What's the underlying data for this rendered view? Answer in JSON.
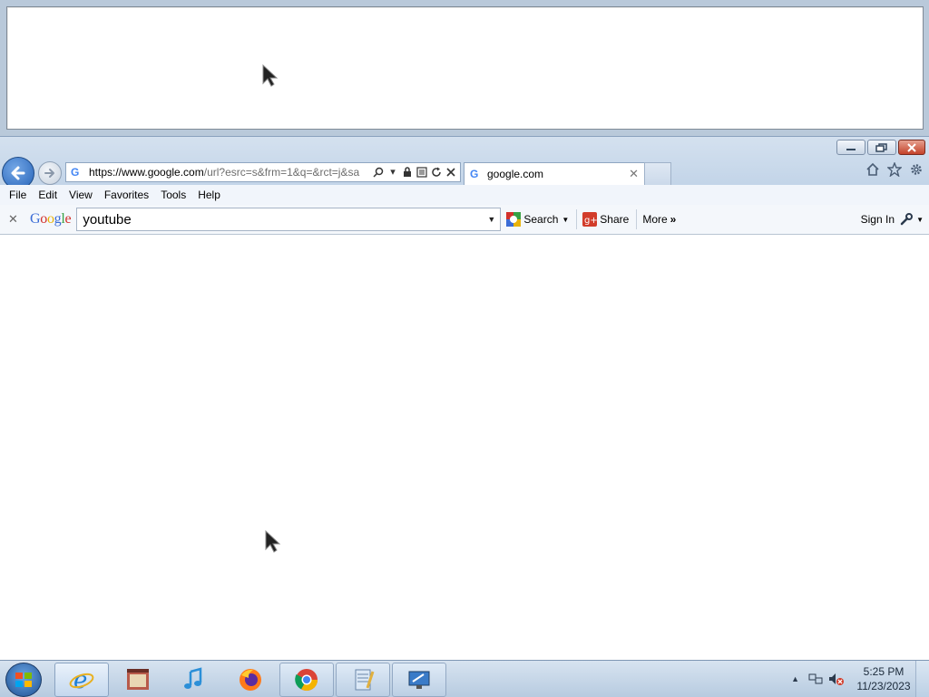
{
  "browser": {
    "address_url_host": "https://www.google.com",
    "address_url_rest": "/url?esrc=s&frm=1&q=&rct=j&sa",
    "tab_title": "google.com",
    "menu": [
      "File",
      "Edit",
      "View",
      "Favorites",
      "Tools",
      "Help"
    ]
  },
  "google_toolbar": {
    "logo": [
      "G",
      "o",
      "o",
      "g",
      "l",
      "e"
    ],
    "search_value": "youtube",
    "search_label": "Search",
    "share_label": "Share",
    "more_label": "More",
    "signin_label": "Sign In"
  },
  "taskbar": {
    "time": "5:25 PM",
    "date": "11/23/2023",
    "apps": [
      "internet-explorer",
      "media-center",
      "itunes",
      "firefox",
      "chrome",
      "notepad",
      "remote-desktop"
    ]
  },
  "icons": {
    "back": "back-arrow-icon",
    "forward": "forward-arrow-icon",
    "home": "home-icon",
    "favorites": "star-icon",
    "tools": "gear-icon"
  }
}
